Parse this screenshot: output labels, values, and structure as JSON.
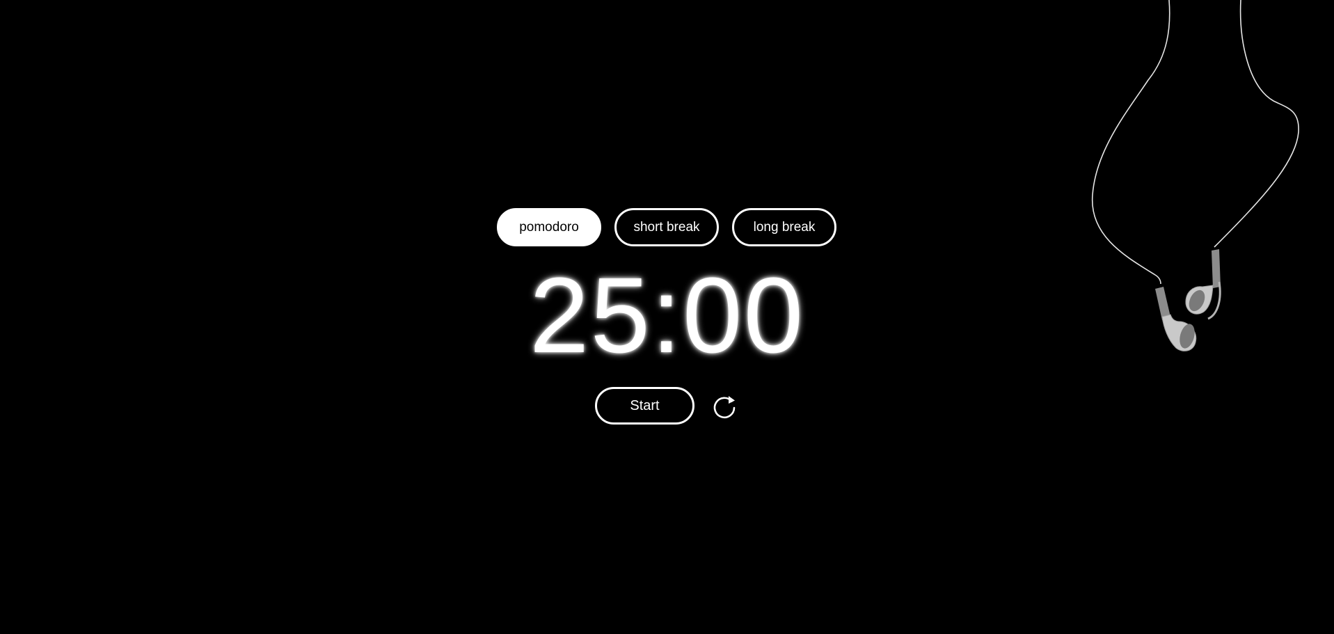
{
  "modes": {
    "pomodoro_label": "pomodoro",
    "short_break_label": "short break",
    "long_break_label": "long break",
    "active": "pomodoro"
  },
  "timer": {
    "display": "25:00"
  },
  "controls": {
    "start_label": "Start",
    "reset_icon": "refresh-icon"
  },
  "decoration": {
    "image": "earphones-illustration"
  },
  "colors": {
    "background": "#000000",
    "foreground": "#ffffff",
    "earbud": "#bdbdbd"
  }
}
